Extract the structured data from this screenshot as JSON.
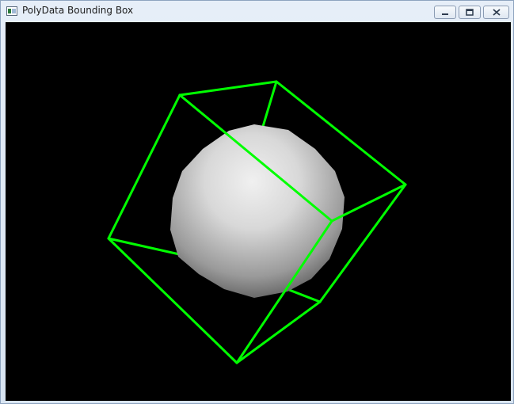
{
  "window": {
    "title": "PolyData Bounding Box",
    "icon": "vtk-window-icon",
    "controls": [
      {
        "name": "minimize",
        "icon": "minimize-icon"
      },
      {
        "name": "maximize",
        "icon": "maximize-icon"
      },
      {
        "name": "close",
        "icon": "close-icon"
      }
    ]
  },
  "scene": {
    "background_color": "#000000",
    "outline_color": "#00ff00",
    "sphere_color": "#e6e6e6",
    "objects": [
      "shaded-sphere",
      "bounding-box-outline"
    ]
  }
}
